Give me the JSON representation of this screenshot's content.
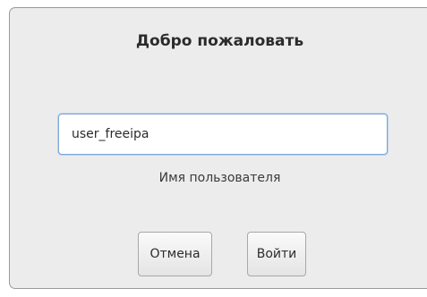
{
  "dialog": {
    "title": "Добро пожаловать",
    "username": {
      "value": "user_freeipa",
      "label": "Имя пользователя"
    },
    "buttons": {
      "cancel": "Отмена",
      "login": "Войти"
    }
  }
}
